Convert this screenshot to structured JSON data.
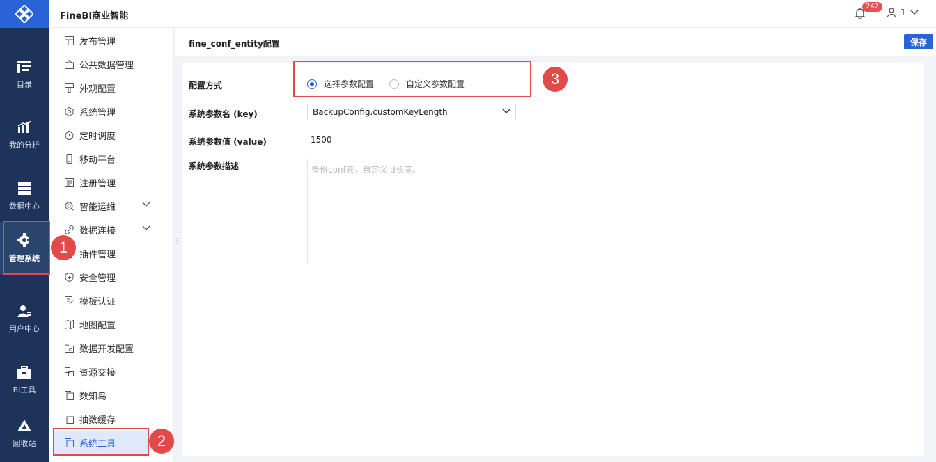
{
  "header": {
    "app_title": "FineBI商业智能",
    "notification_count": "242",
    "user_name": "1"
  },
  "leftnav": [
    {
      "label": "目录",
      "icon": "catalog-icon"
    },
    {
      "label": "我的分析",
      "icon": "analysis-icon"
    },
    {
      "label": "数据中心",
      "icon": "data-center-icon"
    },
    {
      "label": "管理系统",
      "icon": "gear-icon",
      "active": true
    },
    {
      "label": "用户中心",
      "icon": "user-center-icon"
    },
    {
      "label": "BI工具",
      "icon": "toolbox-icon"
    },
    {
      "label": "回收站",
      "icon": "recycle-icon"
    }
  ],
  "submenu": [
    {
      "label": "发布管理"
    },
    {
      "label": "公共数据管理"
    },
    {
      "label": "外观配置"
    },
    {
      "label": "系统管理"
    },
    {
      "label": "定时调度"
    },
    {
      "label": "移动平台"
    },
    {
      "label": "注册管理"
    },
    {
      "label": "智能运维",
      "expandable": true
    },
    {
      "label": "数据连接",
      "expandable": true
    },
    {
      "label": "插件管理"
    },
    {
      "label": "安全管理"
    },
    {
      "label": "模板认证"
    },
    {
      "label": "地图配置"
    },
    {
      "label": "数据开发配置"
    },
    {
      "label": "资源交接"
    },
    {
      "label": "数知鸟"
    },
    {
      "label": "抽数缓存"
    },
    {
      "label": "系统工具",
      "active": true
    }
  ],
  "page": {
    "title": "fine_conf_entity配置",
    "save_label": "保存",
    "form": {
      "mode_label": "配置方式",
      "option_select": "选择参数配置",
      "option_custom": "自定义参数配置",
      "key_label": "系统参数名 (key)",
      "key_value": "BackupConfig.customKeyLength",
      "value_label": "系统参数值 (value)",
      "value_value": "1500",
      "desc_label": "系统参数描述",
      "desc_placeholder": "备份conf表，自定义id长度。"
    }
  },
  "annotations": {
    "step1": "1",
    "step2": "2",
    "step3": "3"
  },
  "colors": {
    "nav_bg": "#1d3359",
    "accent": "#2a63d8",
    "highlight": "#e24a4a"
  }
}
